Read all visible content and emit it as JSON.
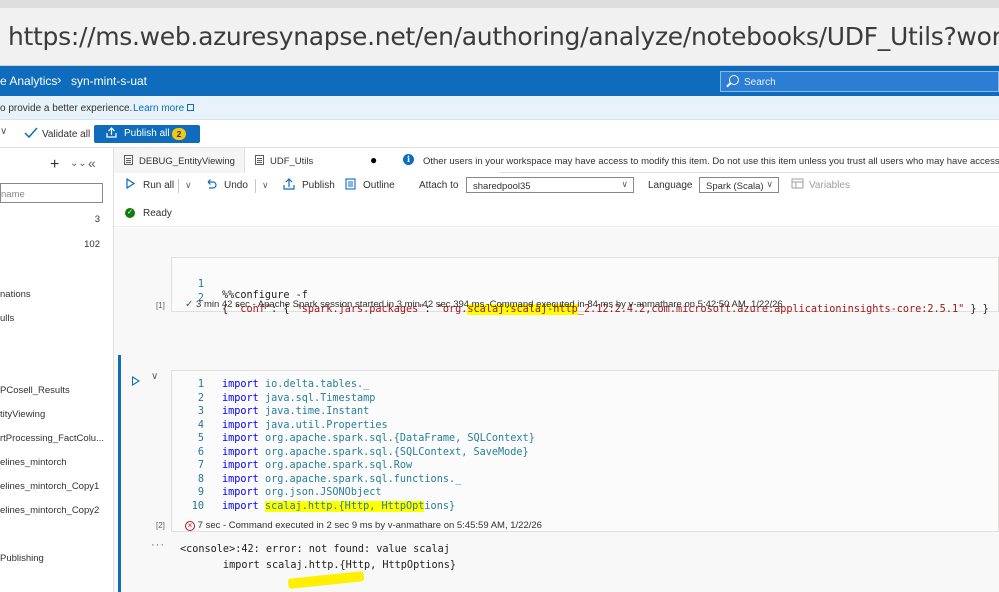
{
  "browser": {
    "url": "https://ms.web.azuresynapse.net/en/authoring/analyze/notebooks/UDF_Utils?workspace=%2Fsubscriptions"
  },
  "header": {
    "app_title": "e Analytics",
    "separator": "›",
    "workspace": "syn-mint-s-uat",
    "search_placeholder": "Search"
  },
  "banner": {
    "text": "o provide a better experience.",
    "link": "Learn more"
  },
  "toolbar": {
    "chevron": "∨",
    "validate_label": "Validate all",
    "publish_label": "Publish all",
    "publish_badge": "2"
  },
  "left_pane": {
    "filter_placeholder": "name",
    "counts": [
      "3",
      "102"
    ],
    "items": [
      "nations",
      "ulls",
      "PCosell_Results",
      "tityViewing",
      "rtProcessing_FactColu...",
      "elines_mintorch",
      "elines_mintorch_Copy1",
      "elines_mintorch_Copy2",
      "Publishing"
    ]
  },
  "tabs": [
    {
      "label": "DEBUG_EntityViewing"
    },
    {
      "label": "UDF_Utils",
      "dirty": "●"
    }
  ],
  "tab_info": "Other users in your workspace may have access to modify this item. Do not use this item unless you trust all users who may have access",
  "editor_toolbar": {
    "run_all": "Run all",
    "undo": "Undo",
    "publish": "Publish",
    "outline": "Outline",
    "attach_to_label": "Attach to",
    "attach_to_value": "sharedpool35",
    "language_label": "Language",
    "language_value": "Spark (Scala)",
    "variables": "Variables"
  },
  "status": "Ready",
  "cell1": {
    "badge": "[1]",
    "lines": [
      {
        "n": "1",
        "text": "%%configure -f"
      },
      {
        "n": "2",
        "pre": "{ ",
        "key": "\"conf\"",
        "mid": ": {",
        "k2": "\"spark.jars.packages\"",
        "colon": ": ",
        "val_a": "\"org.",
        "val_hl": "scalaj:scalaj-http",
        "val_b": "_2.12:2.4.2,com.microsoft.azure:applicationinsights-core:2.5.1\"",
        "end": "} }"
      }
    ],
    "status": "3 min 42 sec - Apache Spark session started in 3 min 42 sec 394 ms. Command executed in 84 ms by v-anmathare on 5:42:50 AM, 1/22/26"
  },
  "cell2": {
    "badge": "[2]",
    "lines": [
      {
        "n": "1",
        "kw": "import",
        "rest": "io.delta.tables._"
      },
      {
        "n": "2",
        "kw": "import",
        "rest": "java.sql.Timestamp"
      },
      {
        "n": "3",
        "kw": "import",
        "rest": "java.time.Instant"
      },
      {
        "n": "4",
        "kw": "import",
        "rest": "java.util.Properties"
      },
      {
        "n": "5",
        "kw": "import",
        "rest": "org.apache.spark.sql.{DataFrame, SQLContext}"
      },
      {
        "n": "6",
        "kw": "import",
        "rest": "org.apache.spark.sql.{SQLContext, SaveMode}"
      },
      {
        "n": "7",
        "kw": "import",
        "rest": "org.apache.spark.sql.Row"
      },
      {
        "n": "8",
        "kw": "import",
        "rest": "org.apache.spark.sql.functions._"
      },
      {
        "n": "9",
        "kw": "import",
        "rest": "org.json.JSONObject"
      },
      {
        "n": "10",
        "kw": "import",
        "hl": "scalaj.http.{Http, HttpOpt",
        "rest": "ions}"
      }
    ],
    "status": "7 sec - Command executed in 2 sec 9 ms by v-anmathare on 5:45:59 AM, 1/22/26"
  },
  "output": {
    "dots": "···",
    "line1": "<console>:42: error: not found: value scalaj",
    "line2": "       import scalaj.http.{Http, HttpOptions}"
  }
}
